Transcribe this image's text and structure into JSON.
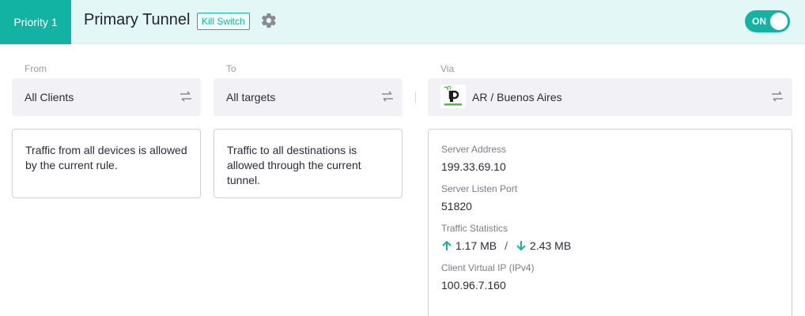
{
  "header": {
    "priority_label": "Priority 1",
    "title": "Primary Tunnel",
    "badge": "Kill Switch",
    "toggle_label": "ON"
  },
  "from": {
    "label": "From",
    "value": "All Clients",
    "description": "Traffic from all devices is allowed by the current rule."
  },
  "to": {
    "label": "To",
    "value": "All targets",
    "description": "Traffic to all destinations is allowed through the current tunnel."
  },
  "via": {
    "label": "Via",
    "value": "AR / Buenos Aires",
    "details": {
      "server_address_label": "Server Address",
      "server_address": "199.33.69.10",
      "listen_port_label": "Server Listen Port",
      "listen_port": "51820",
      "traffic_label": "Traffic Statistics",
      "upload": "1.17 MB",
      "separator": "/",
      "download": "2.43 MB",
      "virtual_ip_label": "Client Virtual IP (IPv4)",
      "virtual_ip": "100.96.7.160"
    }
  },
  "colors": {
    "accent": "#13b3a3",
    "header_bg": "#e4f7f7",
    "selector_bg": "#f2f2f6"
  },
  "icons": {
    "settings": "gear-icon",
    "swap": "swap-arrows-icon",
    "upload": "arrow-up-icon",
    "download": "arrow-down-icon",
    "provider": "provider-logo-icon"
  }
}
